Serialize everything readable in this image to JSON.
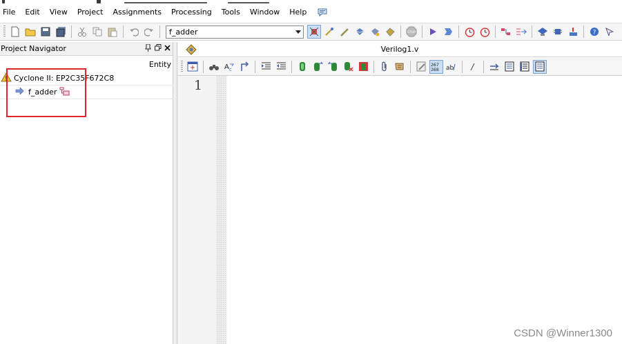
{
  "menubar": {
    "items": [
      "File",
      "Edit",
      "View",
      "Project",
      "Assignments",
      "Processing",
      "Tools",
      "Window",
      "Help"
    ],
    "help_icon": "speech-bubble-icon"
  },
  "toolbar": {
    "entity_combo": {
      "value": "f_adder"
    }
  },
  "project_navigator": {
    "title": "Project Navigator",
    "column_header": "Entity",
    "device": {
      "label": "Cyclone II: EP2C35F672C8",
      "icon": "warning-triangle-icon"
    },
    "entity": {
      "label": "f_adder",
      "icon": "hierarchy-icon"
    }
  },
  "editor": {
    "tab_title": "Verilog1.v",
    "line_number": "1"
  },
  "watermark": "CSDN @Winner1300"
}
